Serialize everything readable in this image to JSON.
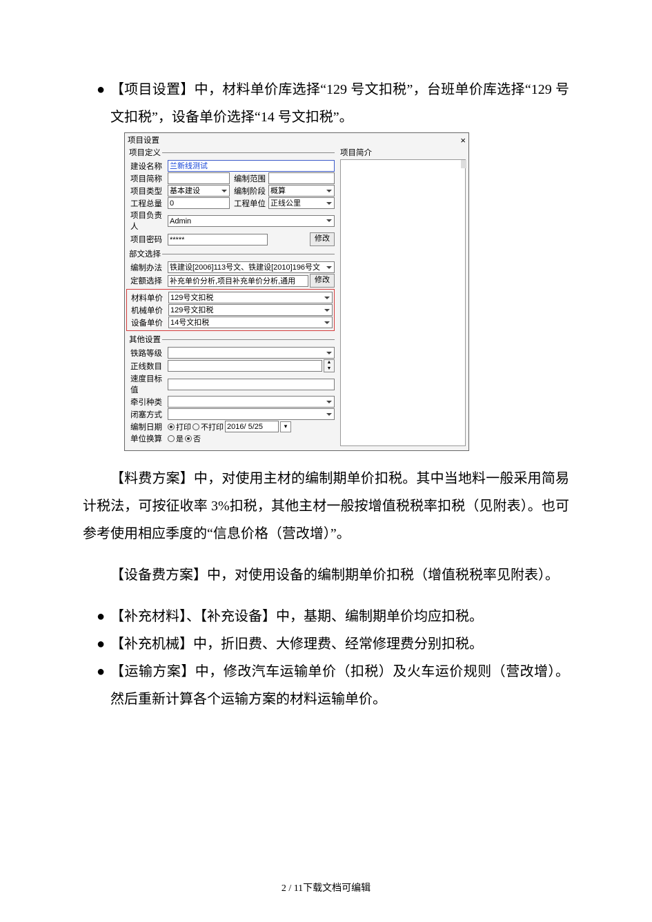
{
  "intro_bullet": "【项目设置】中，材料单价库选择“129 号文扣税”，台班单价库选择“129 号文扣税”，设备单价选择“14 号文扣税”。",
  "dialog": {
    "title": "项目设置",
    "close": "×",
    "right_title": "项目简介",
    "group1": "项目定义",
    "f_name_label": "建设名称",
    "f_name_value": "兰新线测试",
    "f_short_label": "项目简称",
    "f_range_label": "编制范围",
    "f_type_label": "项目类型",
    "f_type_value": "基本建设",
    "f_stage_label": "编制阶段",
    "f_stage_value": "概算",
    "f_total_label": "工程总量",
    "f_total_value": "0",
    "f_unit_label": "工程单位",
    "f_unit_value": "正线公里",
    "f_owner_label": "项目负责人",
    "f_owner_value": "Admin",
    "f_pwd_label": "项目密码",
    "f_pwd_value": "*****",
    "btn_modify": "修改",
    "group2": "部文选择",
    "f_method_label": "编制办法",
    "f_method_value": "铁建设[2006]113号文、铁建设[2010]196号文",
    "f_quota_label": "定额选择",
    "f_quota_value": "补充单价分析,项目补充单价分析,通用",
    "f_mat_label": "材料单价",
    "f_mat_value": "129号文扣税",
    "f_mach_label": "机械单价",
    "f_mach_value": "129号文扣税",
    "f_equip_label": "设备单价",
    "f_equip_value": "14号文扣税",
    "group3": "其他设置",
    "f_rail_label": "铁路等级",
    "f_line_label": "正线数目",
    "f_speed_label": "速度目标值",
    "f_tract_label": "牵引种类",
    "f_block_label": "闭塞方式",
    "f_print_label": "编制日期",
    "radio_print": "打印",
    "radio_noprint": "不打印",
    "date_value": "2016/ 5/25",
    "f_convert_label": "单位换算",
    "radio_yes": "是",
    "radio_no": "否"
  },
  "para1": "【料费方案】中，对使用主材的编制期单价扣税。其中当地料一般采用简易计税法，可按征收率 3%扣税，其他主材一般按增值税税率扣税（见附表）。也可参考使用相应季度的“信息价格（营改增）”。",
  "para2": "【设备费方案】中，对使用设备的编制期单价扣税（增值税税率见附表）。",
  "b1": "【补充材料】、【补充设备】中，基期、编制期单价均应扣税。",
  "b2": "【补充机械】中，折旧费、大修理费、经常修理费分别扣税。",
  "b3": "【运输方案】中，修改汽车运输单价（扣税）及火车运价规则（营改增）。然后重新计算各个运输方案的材料运输单价。",
  "footer": "2 / 11下载文档可编辑"
}
